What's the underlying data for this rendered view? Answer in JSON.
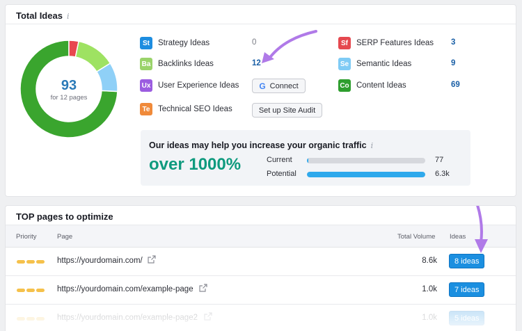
{
  "total_ideas": {
    "title": "Total Ideas",
    "info_icon": "info-icon",
    "donut": {
      "total": "93",
      "subtitle": "for 12 pages",
      "segments": [
        {
          "name": "Content Ideas",
          "value": 69,
          "color": "#3aa52e"
        },
        {
          "name": "SERP Features Ideas",
          "value": 3,
          "color": "#e8474f"
        },
        {
          "name": "Backlinks Ideas",
          "value": 12,
          "color": "#9ee262"
        },
        {
          "name": "Semantic Ideas",
          "value": 9,
          "color": "#8fd0f7"
        }
      ]
    },
    "ideas": [
      {
        "abbr": "St",
        "label": "Strategy Ideas",
        "count": "0",
        "color": "#1d8de0"
      },
      {
        "abbr": "Ba",
        "label": "Backlinks Ideas",
        "count": "12",
        "color": "#9ad36a"
      },
      {
        "abbr": "Ux",
        "label": "User Experience Ideas",
        "count": "",
        "color": "#9b5ce0"
      },
      {
        "abbr": "Te",
        "label": "Technical SEO Ideas",
        "count": "",
        "color": "#f08a3a"
      },
      {
        "abbr": "Sf",
        "label": "SERP Features Ideas",
        "count": "3",
        "color": "#e5484f"
      },
      {
        "abbr": "Se",
        "label": "Semantic Ideas",
        "count": "9",
        "color": "#7fcbf5"
      },
      {
        "abbr": "Co",
        "label": "Content Ideas",
        "count": "69",
        "color": "#2e9e2e"
      }
    ],
    "connect_label": "Connect",
    "site_audit_label": "Set up Site Audit",
    "traffic": {
      "title": "Our ideas may help you increase your organic traffic",
      "big": "over 1000%",
      "current_label": "Current",
      "current_value": "77",
      "current_fraction": 0.012,
      "potential_label": "Potential",
      "potential_value": "6.3k",
      "potential_fraction": 1.0,
      "bar_color": "#2fa9ec"
    }
  },
  "top_pages": {
    "title": "TOP pages to optimize",
    "columns": {
      "priority": "Priority",
      "page": "Page",
      "volume": "Total Volume",
      "ideas": "Ideas"
    },
    "rows": [
      {
        "page": "https://yourdomain.com/",
        "volume": "8.6k",
        "ideas": "8 ideas"
      },
      {
        "page": "https://yourdomain.com/example-page",
        "volume": "1.0k",
        "ideas": "7 ideas"
      },
      {
        "page": "https://yourdomain.com/example-page2",
        "volume": "1.0k",
        "ideas": "5 ideas"
      }
    ]
  },
  "colors": {
    "accent": "#1b8fe0",
    "arrow": "#b07ae8",
    "priority": "#f5c14b"
  }
}
